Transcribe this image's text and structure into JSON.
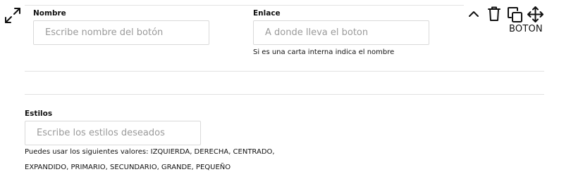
{
  "form": {
    "nombre_label": "Nombre",
    "nombre_placeholder": "Escribe nombre del botón",
    "enlace_label": "Enlace",
    "enlace_placeholder": "A donde lleva el boton",
    "enlace_help": "Si es una carta interna indica el nombre",
    "estilos_label": "Estilos",
    "estilos_placeholder": "Escribe los estilos deseados",
    "estilos_help_line1": "Puedes usar los siguientes valores: IZQUIERDA, DERECHA, CENTRADO,",
    "estilos_help_line2": "EXPANDIDO, PRIMARIO, SECUNDARIO, GRANDE, PEQUEÑO"
  },
  "toolbar": {
    "block_type_label": "BOTON",
    "icons": [
      "expand-icon",
      "collapse-chevron-icon",
      "delete-icon",
      "duplicate-icon",
      "move-icon"
    ]
  }
}
